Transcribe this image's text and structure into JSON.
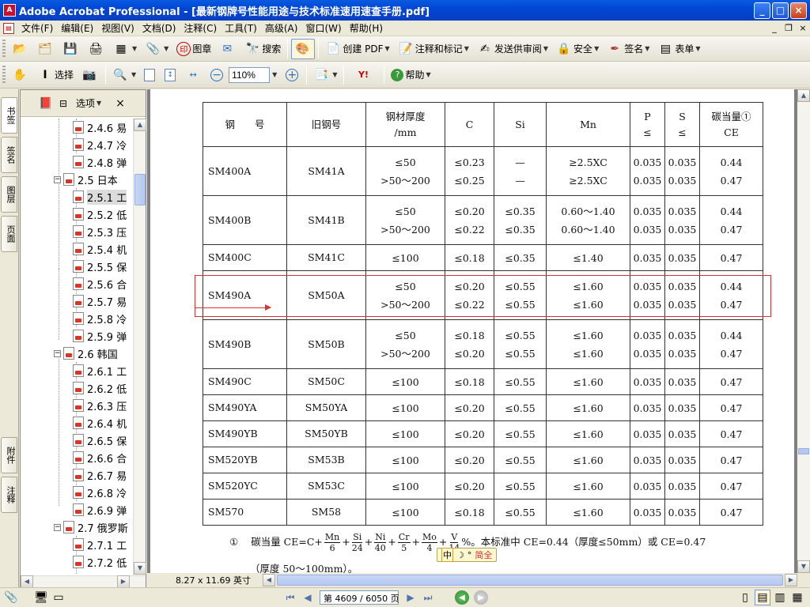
{
  "window": {
    "title": "Adobe Acrobat Professional - [最新钢牌号性能用途与技术标准速用速查手册.pdf]",
    "app_icon": "acrobat-icon",
    "controls": [
      "_",
      "□",
      "×"
    ]
  },
  "menubar": {
    "items": [
      "文件(F)",
      "编辑(E)",
      "视图(V)",
      "文档(D)",
      "注释(C)",
      "工具(T)",
      "高级(A)",
      "窗口(W)",
      "帮助(H)"
    ],
    "mdi_controls": [
      "_",
      "❐",
      "×"
    ]
  },
  "toolbar1": {
    "stamp_label": "图章",
    "search_label": "搜索",
    "create_pdf_label": "创建 PDF",
    "comment_label": "注释和标记",
    "review_label": "发送供审阅",
    "security_label": "安全",
    "sign_label": "签名",
    "forms_label": "表单"
  },
  "toolbar2": {
    "select_label": "选择",
    "zoom_value": "110%",
    "help_label": "帮助"
  },
  "side_tabs": [
    "书签",
    "签名",
    "图层",
    "页面",
    "附件",
    "注释"
  ],
  "bookmarks": {
    "options_label": "选项",
    "close": "×",
    "items": [
      {
        "label": "2.4.6 易",
        "level": 2
      },
      {
        "label": "2.4.7 冷",
        "level": 2
      },
      {
        "label": "2.4.8 弹",
        "level": 2
      },
      {
        "label": "2.5 日本",
        "level": 1
      },
      {
        "label": "2.5.1 工",
        "level": 2,
        "selected": true
      },
      {
        "label": "2.5.2 低",
        "level": 2
      },
      {
        "label": "2.5.3 压",
        "level": 2
      },
      {
        "label": "2.5.4 机",
        "level": 2
      },
      {
        "label": "2.5.5 保",
        "level": 2
      },
      {
        "label": "2.5.6 合",
        "level": 2
      },
      {
        "label": "2.5.7 易",
        "level": 2
      },
      {
        "label": "2.5.8 冷",
        "level": 2
      },
      {
        "label": "2.5.9 弹",
        "level": 2
      },
      {
        "label": "2.6 韩国",
        "level": 1
      },
      {
        "label": "2.6.1 工",
        "level": 2
      },
      {
        "label": "2.6.2 低",
        "level": 2
      },
      {
        "label": "2.6.3 压",
        "level": 2
      },
      {
        "label": "2.6.4 机",
        "level": 2
      },
      {
        "label": "2.6.5 保",
        "level": 2
      },
      {
        "label": "2.6.6 合",
        "level": 2
      },
      {
        "label": "2.6.7 易",
        "level": 2
      },
      {
        "label": "2.6.8 冷",
        "level": 2
      },
      {
        "label": "2.6.9 弹",
        "level": 2
      },
      {
        "label": "2.7 俄罗斯",
        "level": 1
      },
      {
        "label": "2.7.1 工",
        "level": 2
      },
      {
        "label": "2.7.2 低",
        "level": 2
      }
    ]
  },
  "document": {
    "page_size": "8.27 x 11.69 英寸",
    "table": {
      "headers": [
        "钢　　号",
        "旧钢号",
        "钢材厚度\n/mm",
        "C",
        "Si",
        "Mn",
        "P\n≤",
        "S\n≤",
        "碳当量①\nCE"
      ],
      "rows": [
        {
          "grade": "SM400A",
          "old": "SM41A",
          "thickness": [
            "≤50",
            ">50～200"
          ],
          "c": [
            "≤0.23",
            "≤0.25"
          ],
          "si": [
            "—",
            "—"
          ],
          "mn": [
            "≥2.5XC",
            "≥2.5XC"
          ],
          "p": [
            "0.035",
            "0.035"
          ],
          "s": [
            "0.035",
            "0.035"
          ],
          "ce": [
            "0.44",
            "0.47"
          ]
        },
        {
          "grade": "SM400B",
          "old": "SM41B",
          "thickness": [
            "≤50",
            ">50～200"
          ],
          "c": [
            "≤0.20",
            "≤0.22"
          ],
          "si": [
            "≤0.35",
            "≤0.35"
          ],
          "mn": [
            "0.60～1.40",
            "0.60～1.40"
          ],
          "p": [
            "0.035",
            "0.035"
          ],
          "s": [
            "0.035",
            "0.035"
          ],
          "ce": [
            "0.44",
            "0.47"
          ]
        },
        {
          "grade": "SM400C",
          "old": "SM41C",
          "thickness": [
            "≤100"
          ],
          "c": [
            "≤0.18"
          ],
          "si": [
            "≤0.35"
          ],
          "mn": [
            "≤1.40"
          ],
          "p": [
            "0.035"
          ],
          "s": [
            "0.035"
          ],
          "ce": [
            "0.47"
          ]
        },
        {
          "grade": "SM490A",
          "old": "SM50A",
          "thickness": [
            "≤50",
            ">50～200"
          ],
          "c": [
            "≤0.20",
            "≤0.22"
          ],
          "si": [
            "≤0.55",
            "≤0.55"
          ],
          "mn": [
            "≤1.60",
            "≤1.60"
          ],
          "p": [
            "0.035",
            "0.035"
          ],
          "s": [
            "0.035",
            "0.035"
          ],
          "ce": [
            "0.44",
            "0.47"
          ]
        },
        {
          "grade": "SM490B",
          "old": "SM50B",
          "thickness": [
            "≤50",
            ">50～200"
          ],
          "c": [
            "≤0.18",
            "≤0.20"
          ],
          "si": [
            "≤0.55",
            "≤0.55"
          ],
          "mn": [
            "≤1.60",
            "≤1.60"
          ],
          "p": [
            "0.035",
            "0.035"
          ],
          "s": [
            "0.035",
            "0.035"
          ],
          "ce": [
            "0.44",
            "0.47"
          ]
        },
        {
          "grade": "SM490C",
          "old": "SM50C",
          "thickness": [
            "≤100"
          ],
          "c": [
            "≤0.18"
          ],
          "si": [
            "≤0.55"
          ],
          "mn": [
            "≤1.60"
          ],
          "p": [
            "0.035"
          ],
          "s": [
            "0.035"
          ],
          "ce": [
            "0.47"
          ]
        },
        {
          "grade": "SM490YA",
          "old": "SM50YA",
          "thickness": [
            "≤100"
          ],
          "c": [
            "≤0.20"
          ],
          "si": [
            "≤0.55"
          ],
          "mn": [
            "≤1.60"
          ],
          "p": [
            "0.035"
          ],
          "s": [
            "0.035"
          ],
          "ce": [
            "0.47"
          ]
        },
        {
          "grade": "SM490YB",
          "old": "SM50YB",
          "thickness": [
            "≤100"
          ],
          "c": [
            "≤0.20"
          ],
          "si": [
            "≤0.55"
          ],
          "mn": [
            "≤1.60"
          ],
          "p": [
            "0.035"
          ],
          "s": [
            "0.035"
          ],
          "ce": [
            "0.47"
          ]
        },
        {
          "grade": "SM520YB",
          "old": "SM53B",
          "thickness": [
            "≤100"
          ],
          "c": [
            "≤0.20"
          ],
          "si": [
            "≤0.55"
          ],
          "mn": [
            "≤1.60"
          ],
          "p": [
            "0.035"
          ],
          "s": [
            "0.035"
          ],
          "ce": [
            "0.47"
          ]
        },
        {
          "grade": "SM520YC",
          "old": "SM53C",
          "thickness": [
            "≤100"
          ],
          "c": [
            "≤0.20"
          ],
          "si": [
            "≤0.55"
          ],
          "mn": [
            "≤1.60"
          ],
          "p": [
            "0.035"
          ],
          "s": [
            "0.035"
          ],
          "ce": [
            "0.47"
          ]
        },
        {
          "grade": "SM570",
          "old": "SM58",
          "thickness": [
            "≤100"
          ],
          "c": [
            "≤0.18"
          ],
          "si": [
            "≤0.55"
          ],
          "mn": [
            "≤1.60"
          ],
          "p": [
            "0.035"
          ],
          "s": [
            "0.035"
          ],
          "ce": [
            "0.47"
          ]
        }
      ]
    },
    "footnote": {
      "marker": "①",
      "lead": "碳当量 CE=C+",
      "fractions": [
        [
          "Mn",
          "6"
        ],
        [
          "Si",
          "24"
        ],
        [
          "Ni",
          "40"
        ],
        [
          "Cr",
          "5"
        ],
        [
          "Mo",
          "4"
        ],
        [
          "V",
          "14"
        ]
      ],
      "tail": "%。本标准中 CE=0.44（厚度≤50mm）或 CE=0.47",
      "line2": "（厚度 50～100mm）。"
    },
    "ime_bar": [
      "中",
      "☽",
      "°",
      "简全"
    ],
    "highlight_color": "#d33333"
  },
  "statusbar": {
    "page_indicator": "第 4609 / 6050 页"
  }
}
